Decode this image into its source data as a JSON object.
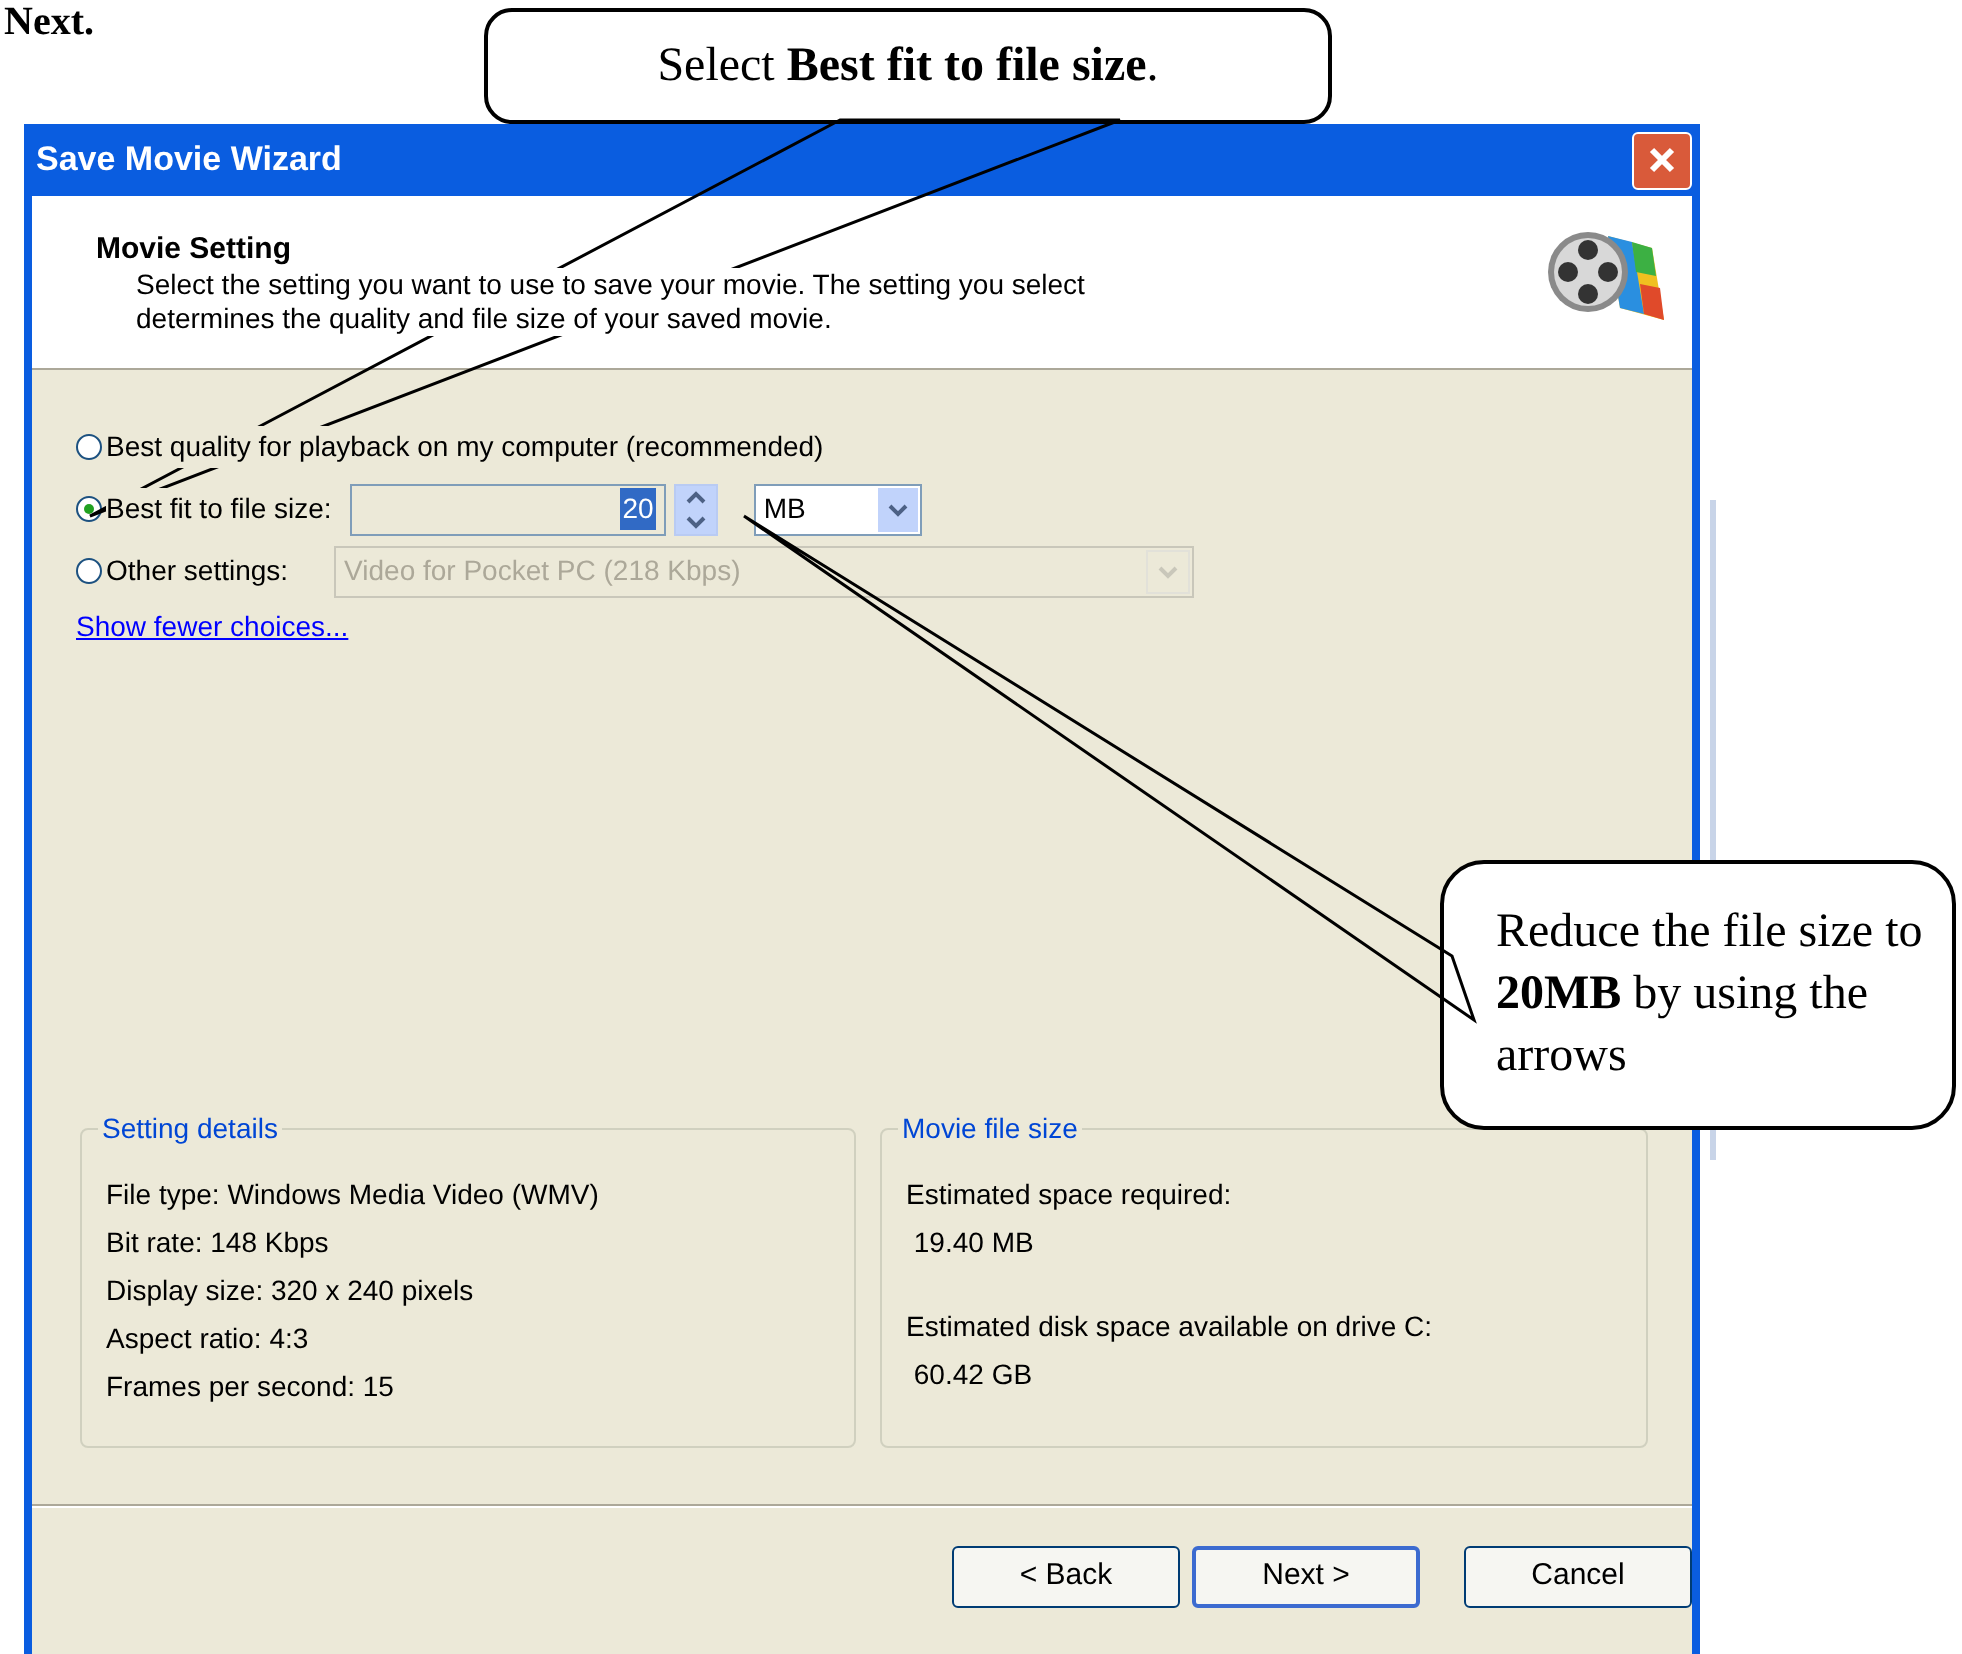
{
  "heading": "Next.",
  "window": {
    "title": "Save Movie Wizard"
  },
  "header": {
    "title": "Movie Setting",
    "description_lines": [
      "Select the setting you want to use to save your movie. The setting you select",
      "determines the quality and file size of your saved movie."
    ]
  },
  "options": [
    {
      "kind": "plain",
      "label": "Best quality for playback on my computer (recommended)",
      "selected": false
    },
    {
      "kind": "size",
      "label": "Best fit to file size:",
      "selected": true,
      "value": "20",
      "unit": "MB"
    },
    {
      "kind": "preset",
      "label": "Other settings:",
      "selected": false,
      "value": "Video for Pocket PC (218 Kbps)",
      "disabled": true
    }
  ],
  "link": "Show fewer choices...",
  "groups": [
    {
      "title": "Setting details",
      "lines": [
        "File type: Windows Media Video (WMV)",
        "Bit rate: 148 Kbps",
        "Display size: 320 x 240 pixels",
        "Aspect ratio: 4:3",
        "Frames per second: 15"
      ]
    },
    {
      "title": "Movie file size",
      "entries": [
        {
          "label": "Estimated space required:",
          "value": " 19.40 MB"
        },
        {
          "label": "Estimated disk space available on drive C:",
          "value": " 60.42 GB"
        }
      ]
    }
  ],
  "buttons": [
    {
      "label": "< Back",
      "default": false
    },
    {
      "label": "Next >",
      "default": true
    },
    {
      "label": "Cancel",
      "default": false
    }
  ],
  "callouts": [
    "Select **Best fit to file size**.",
    "Reduce the file size to **20MB** by using the arrows"
  ]
}
